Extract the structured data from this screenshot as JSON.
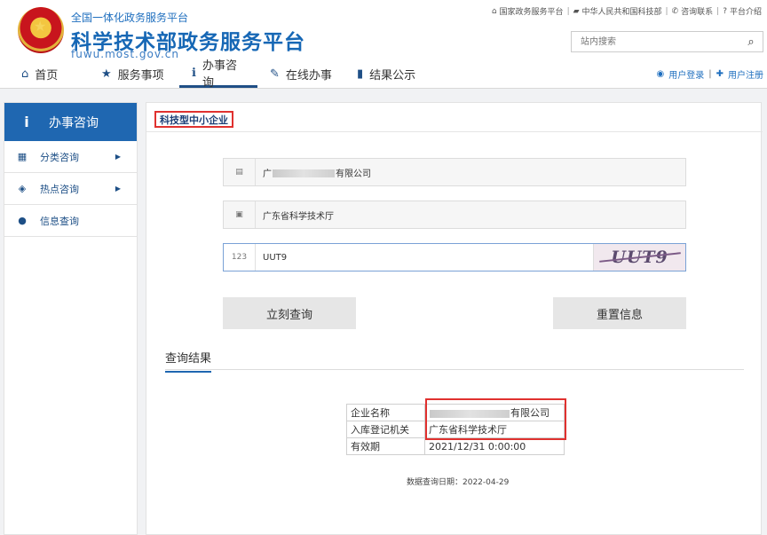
{
  "header": {
    "subtitle": "全国一体化政务服务平台",
    "title": "科学技术部政务服务平台",
    "domain": "fuwu.most.gov.cn"
  },
  "top_links": [
    {
      "icon": "home-icon",
      "label": "国家政务服务平台"
    },
    {
      "icon": "flag-icon",
      "label": "中华人民共和国科技部"
    },
    {
      "icon": "phone-icon",
      "label": "咨询联系"
    },
    {
      "icon": "help-icon",
      "label": "平台介绍"
    }
  ],
  "search": {
    "placeholder": "站内搜索"
  },
  "nav": [
    {
      "icon": "home-icon",
      "label": "首页"
    },
    {
      "icon": "star-icon",
      "label": "服务事项"
    },
    {
      "icon": "info-icon",
      "label": "办事咨询",
      "active": true
    },
    {
      "icon": "pencil-icon",
      "label": "在线办事"
    },
    {
      "icon": "book-icon",
      "label": "结果公示"
    }
  ],
  "user": {
    "login": "用户登录",
    "register": "用户注册"
  },
  "sidebar": {
    "header": "办事咨询",
    "items": [
      {
        "icon": "grid-icon",
        "label": "分类咨询",
        "arrow": true
      },
      {
        "icon": "fire-icon",
        "label": "热点咨询",
        "arrow": true
      },
      {
        "icon": "bulb-icon",
        "label": "信息查询",
        "arrow": false
      }
    ]
  },
  "main": {
    "section_title": "科技型中小企业",
    "form": {
      "company_prefix": "广",
      "company_suffix": "有限公司",
      "authority": "广东省科学技术厅",
      "captcha_input": "UUT9",
      "captcha_image_text": "UUT9"
    },
    "buttons": {
      "query": "立刻查询",
      "reset": "重置信息"
    },
    "result_title": "查询结果",
    "result_rows": [
      {
        "key": "企业名称",
        "value_suffix": "有限公司"
      },
      {
        "key": "入库登记机关",
        "value": "广东省科学技术厅"
      },
      {
        "key": "有效期",
        "value": "2021/12/31 0:00:00"
      }
    ],
    "query_date": "数据查询日期：2022-04-29"
  },
  "colors": {
    "brand_blue": "#1f67b1",
    "highlight_red": "#e0312f"
  }
}
